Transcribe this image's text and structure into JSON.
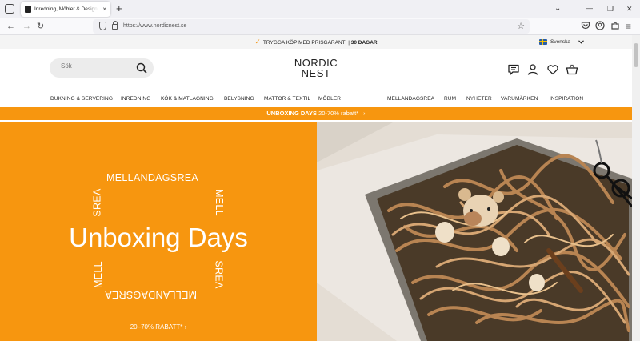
{
  "browser": {
    "tab_title": "Inredning, Möbler & Design en",
    "tab_close": "×",
    "new_tab": "+",
    "url": "https://www.nordicnest.se",
    "star": "☆",
    "win_min": "⌄",
    "win_minimize": "—",
    "win_restore": "❐",
    "win_close": "✕",
    "back": "←",
    "forward": "→",
    "reload": "↻",
    "menu": "≡"
  },
  "site": {
    "promo_text": "TRYGGA KÖP MED PRISGARANTI | ",
    "promo_bold": "30 DAGAR",
    "language": "Svenska",
    "search_placeholder": "Sök",
    "logo_line1": "NORDIC",
    "logo_line2": "NEST",
    "nav_left": [
      "DUKNING & SERVERING",
      "INREDNING",
      "KÖK & MATLAGNING",
      "BELYSNING",
      "MATTOR & TEXTIL",
      "MÖBLER"
    ],
    "nav_right": [
      "MELLANDAGSREA",
      "RUM",
      "NYHETER",
      "VARUMÄRKEN",
      "INSPIRATION"
    ],
    "strip_bold": "UNBOXING DAYS",
    "strip_text": " 20-70% rabatt*",
    "strip_arrow": "›"
  },
  "hero": {
    "title": "Unboxing Days",
    "ring_top": "MELLANDAGSREA",
    "ring_bottom": "MELLANDAGSREA",
    "ring_left_top": "SREA",
    "ring_right_top": "MELL",
    "ring_left_bottom": "MELL",
    "ring_right_bottom": "SREA",
    "cta": "20–70% RABATT* ›"
  },
  "icons": [
    "tab-list-icon",
    "search-icon",
    "chat-icon",
    "user-icon",
    "heart-icon",
    "cart-icon",
    "check-icon",
    "chevron-down-icon",
    "shield-icon",
    "lock-icon",
    "pocket-icon",
    "account-icon",
    "extensions-icon"
  ],
  "colors": {
    "accent": "#f7960f",
    "promo_bg": "#f4f4f4",
    "search_bg": "#ececec"
  }
}
